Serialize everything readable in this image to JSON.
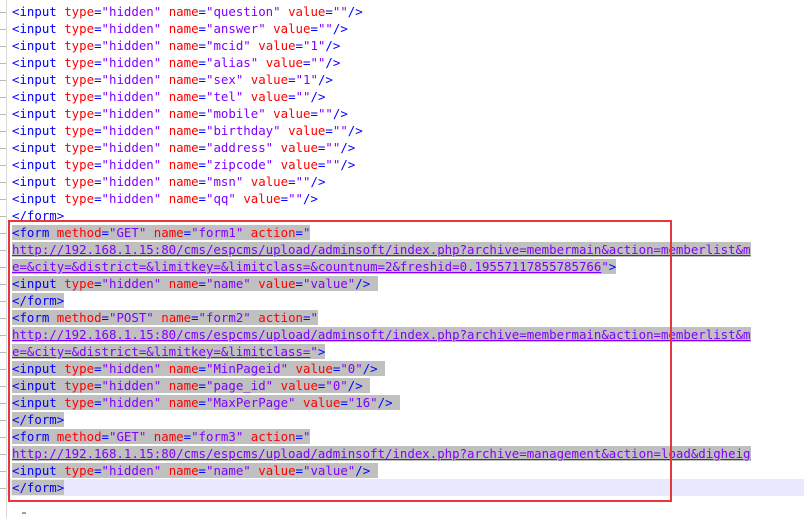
{
  "code_lines": [
    {
      "kind": "input",
      "name": "question",
      "value": ""
    },
    {
      "kind": "input",
      "name": "answer",
      "value": ""
    },
    {
      "kind": "input",
      "name": "mcid",
      "value": "1"
    },
    {
      "kind": "input",
      "name": "alias",
      "value": ""
    },
    {
      "kind": "input",
      "name": "sex",
      "value": "1"
    },
    {
      "kind": "input",
      "name": "tel",
      "value": ""
    },
    {
      "kind": "input",
      "name": "mobile",
      "value": ""
    },
    {
      "kind": "input",
      "name": "birthday",
      "value": ""
    },
    {
      "kind": "input",
      "name": "address",
      "value": ""
    },
    {
      "kind": "input",
      "name": "zipcode",
      "value": ""
    },
    {
      "kind": "input",
      "name": "msn",
      "value": ""
    },
    {
      "kind": "input",
      "name": "qq",
      "value": ""
    }
  ],
  "form_close": "</form>",
  "selected": {
    "form1": {
      "method": "GET",
      "name": "form1",
      "url_line1": "http://192.168.1.15:80/cms/espcms/upload/adminsoft/index.php?archive=membermain&action=memberlist&m",
      "url_line2": "e=&city=&district=&limitkey=&limitclass=&countnum=2&freshid=0.19557117855785766",
      "input_name": "name",
      "input_value": "value"
    },
    "form2": {
      "method": "POST",
      "name": "form2",
      "url_line1": "http://192.168.1.15:80/cms/espcms/upload/adminsoft/index.php?archive=membermain&action=memberlist&m",
      "url_line2": "e=&city=&district=&limitkey=&limitclass=",
      "inputs": [
        {
          "name": "MinPageid",
          "value": "0"
        },
        {
          "name": "page_id",
          "value": "0"
        },
        {
          "name": "MaxPerPage",
          "value": "16"
        }
      ]
    },
    "form3": {
      "method": "GET",
      "name": "form3",
      "url_line1": "http://192.168.1.15:80/cms/espcms/upload/adminsoft/index.php?archive=management&action=load&digheig",
      "input_name": "name",
      "input_value": "value"
    }
  },
  "colors": {
    "tag": "#0000ff",
    "attribute": "#ff0000",
    "value": "#8000ff",
    "selection": "#c0c0c0",
    "highlight_box": "#e8373a"
  }
}
